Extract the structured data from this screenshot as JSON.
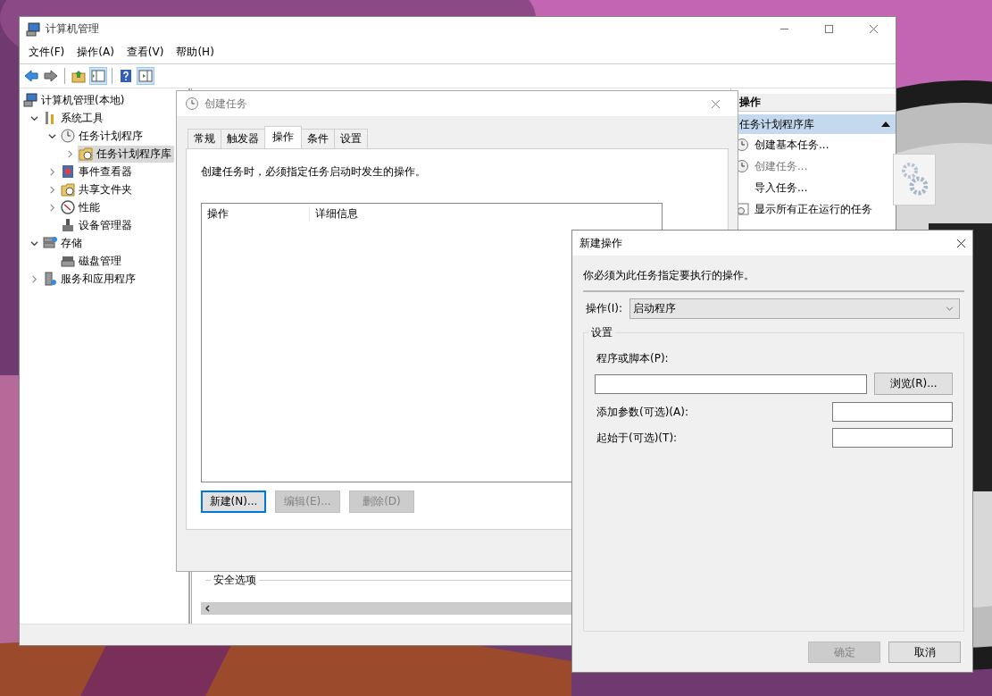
{
  "main_window": {
    "title": "计算机管理",
    "menu": [
      "文件(F)",
      "操作(A)",
      "查看(V)",
      "帮助(H)"
    ],
    "toolbar": [
      {
        "pressed": false
      },
      {
        "pressed": false
      },
      {
        "pressed": false
      },
      {
        "pressed": true
      },
      {
        "pressed": false
      },
      {
        "pressed": true
      }
    ],
    "tree": [
      {
        "label": "计算机管理(本地)",
        "selected": false,
        "children": [
          {
            "label": "系统工具",
            "expanded": true,
            "selected": false,
            "children": [
              {
                "label": "任务计划程序",
                "expanded": true,
                "selected": false,
                "children": [
                  {
                    "label": "任务计划程序库",
                    "expanded": false,
                    "selected": true
                  }
                ]
              },
              {
                "label": "事件查看器",
                "expanded": false,
                "selected": false
              },
              {
                "label": "共享文件夹",
                "expanded": false,
                "selected": false
              },
              {
                "label": "性能",
                "expanded": false,
                "selected": false
              },
              {
                "label": "设备管理器",
                "selected": false
              }
            ]
          },
          {
            "label": "存储",
            "expanded": true,
            "selected": false,
            "children": [
              {
                "label": "磁盘管理",
                "selected": false
              }
            ]
          },
          {
            "label": "服务和应用程序",
            "expanded": false,
            "selected": false
          }
        ]
      }
    ],
    "center": {
      "group_title": "安全选项"
    },
    "actions_pane": {
      "header": "操作",
      "section": {
        "label": "任务计划程序库",
        "expanded": true
      },
      "items": [
        {
          "label": "创建基本任务...",
          "disabled": false
        },
        {
          "label": "创建任务...",
          "disabled": true
        },
        {
          "label": "导入任务...",
          "disabled": false
        },
        {
          "label": "显示所有正在运行的任务",
          "disabled": false
        }
      ]
    }
  },
  "create_task_dialog": {
    "title": "创建任务",
    "tabs": [
      {
        "label": "常规",
        "selected": false
      },
      {
        "label": "触发器",
        "selected": false
      },
      {
        "label": "操作",
        "selected": true
      },
      {
        "label": "条件",
        "selected": false
      },
      {
        "label": "设置",
        "selected": false
      }
    ],
    "description": "创建任务时，必须指定任务启动时发生的操作。",
    "table": {
      "columns": [
        "操作",
        "详细信息"
      ]
    },
    "buttons": [
      {
        "label": "新建(N)...",
        "disabled": false,
        "focused": true
      },
      {
        "label": "编辑(E)...",
        "disabled": true,
        "focused": false
      },
      {
        "label": "删除(D)",
        "disabled": true,
        "focused": false
      }
    ]
  },
  "new_action_dialog": {
    "title": "新建操作",
    "description": "你必须为此任务指定要执行的操作。",
    "action_label": "操作(I):",
    "action_value": "启动程序",
    "group_title": "设置",
    "program_label": "程序或脚本(P):",
    "browse_button": "浏览(R)...",
    "fields": [
      {
        "label": "添加参数(可选)(A):"
      },
      {
        "label": "起始于(可选)(T):"
      }
    ],
    "buttons": [
      {
        "label": "确定",
        "disabled": true
      },
      {
        "label": "取消",
        "disabled": false
      }
    ]
  }
}
